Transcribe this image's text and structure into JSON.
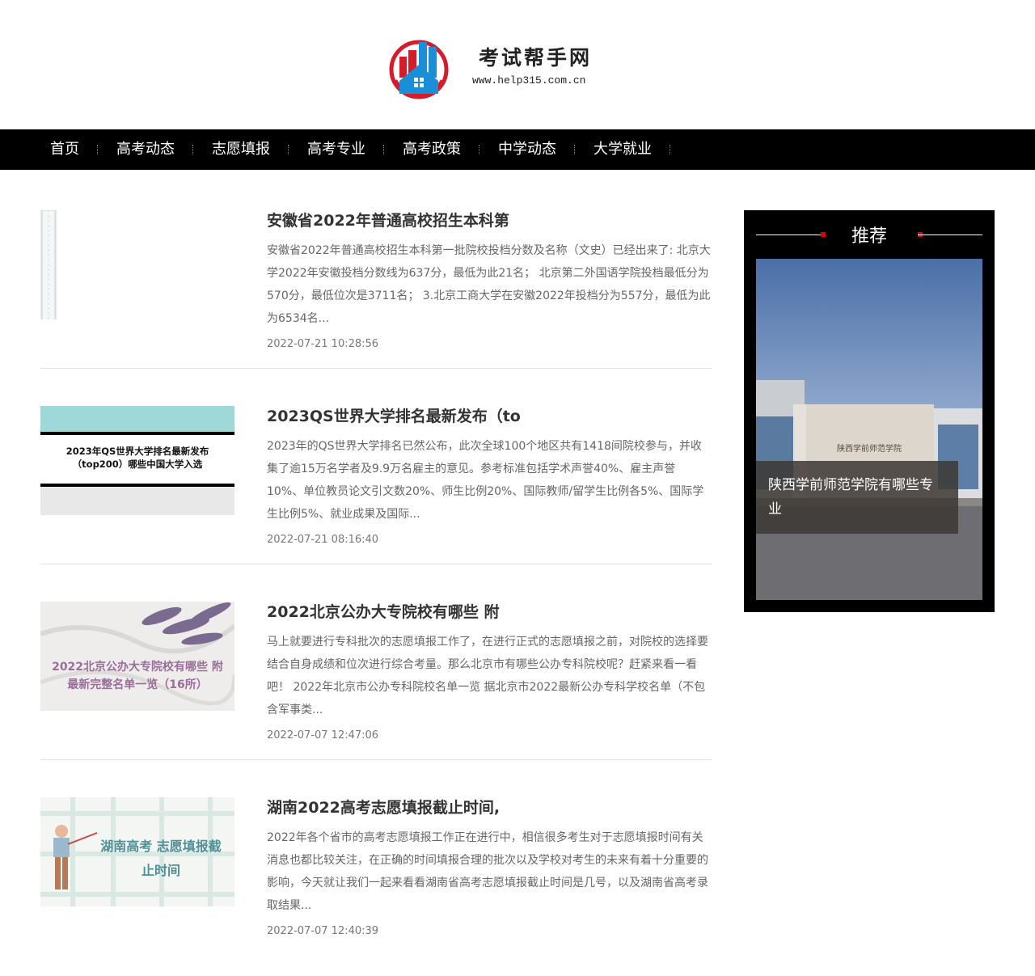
{
  "site": {
    "name": "考试帮手网",
    "url": "www.help315.com.cn"
  },
  "nav": {
    "items": [
      "首页",
      "高考动态",
      "志愿填报",
      "高考专业",
      "高考政策",
      "中学动态",
      "大学就业"
    ]
  },
  "articles": [
    {
      "title": "安徽省2022年普通高校招生本科第",
      "summary": "安徽省2022年普通高校招生本科第一批院校投档分数及名称（文史）已经出来了: 北京大学2022年安徽投档分数线为637分，最低为此21名； 北京第二外国语学院投档最低分为570分，最低位次是3711名； 3.北京工商大学在安徽2022年投档分为557分，最低为此为6534名...",
      "date": "2022-07-21 10:28:56",
      "thumb_text": ""
    },
    {
      "title": "2023QS世界大学排名最新发布（to",
      "summary": "2023年的QS世界大学排名已然公布，此次全球100个地区共有1418间院校参与，并收集了逾15万名学者及9.9万名雇主的意见。参考标准包括学术声誉40%、雇主声誉10%、单位教员论文引文数20%、师生比例20%、国际教师/留学生比例各5%、国际学生比例5%、就业成果及国际...",
      "date": "2022-07-21 08:16:40",
      "thumb_text": "2023年QS世界大学排名最新发布（top200）哪些中国大学入选"
    },
    {
      "title": "2022北京公办大专院校有哪些 附",
      "summary": "马上就要进行专科批次的志愿填报工作了，在进行正式的志愿填报之前，对院校的选择要结合自身成绩和位次进行综合考量。那么北京市有哪些公办专科院校呢？赶紧来看一看吧！ 2022年北京市公办专科院校名单一览 据北京市2022最新公办专科学校名单（不包含军事类...",
      "date": "2022-07-07 12:47:06",
      "thumb_text": "2022北京公办大专院校有哪些 附最新完整名单一览（16所）"
    },
    {
      "title": "湖南2022高考志愿填报截止时间,",
      "summary": "2022年各个省市的高考志愿填报工作正在进行中，相信很多考生对于志愿填报时间有关消息也都比较关注，在正确的时间填报合理的批次以及学校对考生的未来有着十分重要的影响，今天就让我们一起来看看湖南省高考志愿填报截止时间是几号，以及湖南省高考录取结果...",
      "date": "2022-07-07 12:40:39",
      "thumb_text": "湖南高考 志愿填报截止时间"
    }
  ],
  "sidebar": {
    "title": "推荐",
    "caption": "陕西学前师范学院有哪些专业",
    "image_text": "陕西学前师范学院"
  }
}
